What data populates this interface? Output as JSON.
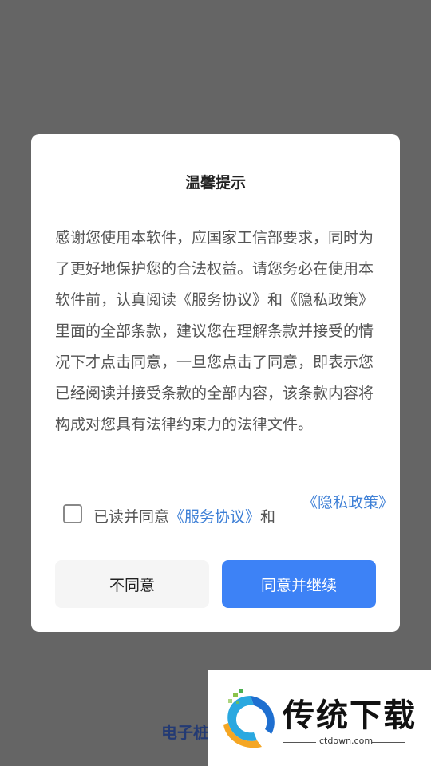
{
  "background": {
    "partial_text": "电子桩"
  },
  "dialog": {
    "title": "温馨提示",
    "body": "感谢您使用本软件，应国家工信部要求，同时为了更好地保护您的合法权益。请您务必在使用本软件前，认真阅读《服务协议》和《隐私政策》里面的全部条款，建议您在理解条款并接受的情况下才点击同意，一旦您点击了同意，即表示您已经阅读并接受条款的全部内容，该条款内容将构成对您具有法律约束力的法律文件。",
    "agreement": {
      "checked": false,
      "prefix": "已读并同意",
      "service_link": "《服务协议》",
      "conjunction": "和",
      "privacy_link": "《隐私政策》"
    },
    "decline_label": "不同意",
    "accept_label": "同意并继续"
  },
  "watermark": {
    "title": "传统下载",
    "url": "ctdown.com"
  },
  "colors": {
    "overlay": "#656565",
    "accent": "#3d82f6",
    "link": "#3d7fd6"
  }
}
